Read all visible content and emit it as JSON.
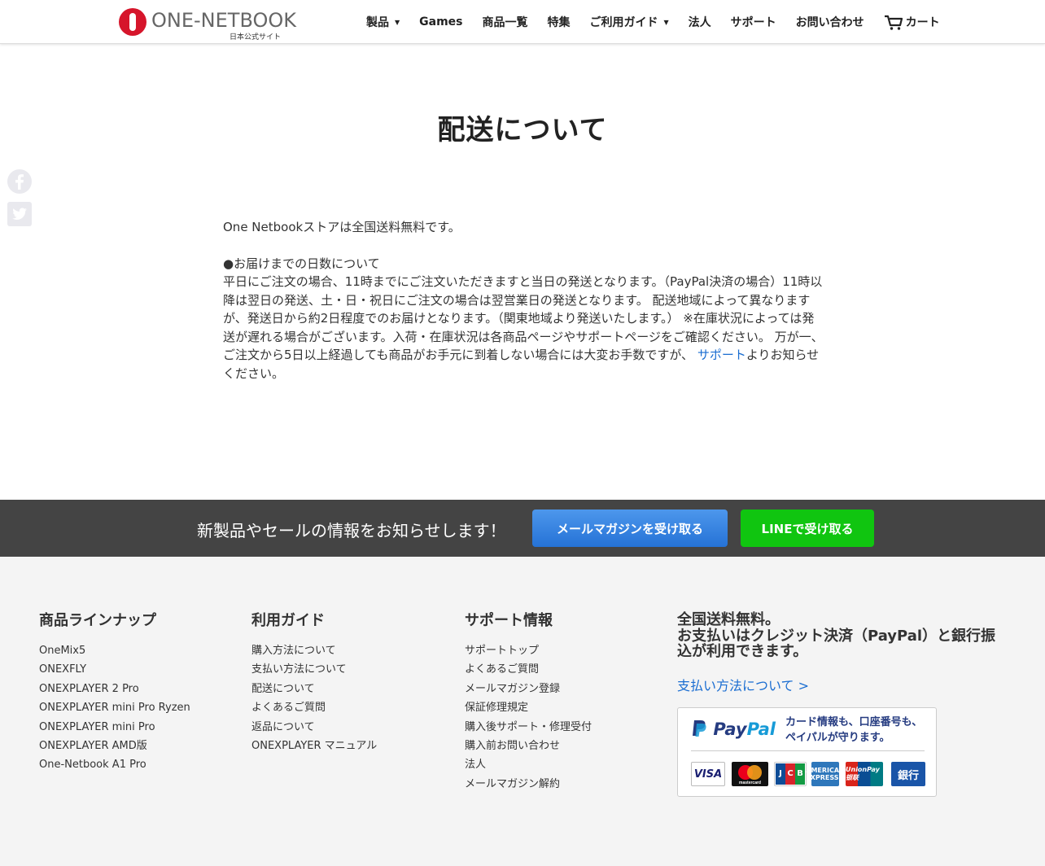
{
  "header": {
    "logo_text": "ONE-NETBOOK",
    "logo_sub": "日本公式サイト",
    "nav": [
      {
        "label": "製品",
        "has_dropdown": true
      },
      {
        "label": "Games",
        "has_dropdown": false
      },
      {
        "label": "商品一覧",
        "has_dropdown": false
      },
      {
        "label": "特集",
        "has_dropdown": false
      },
      {
        "label": "ご利用ガイド",
        "has_dropdown": true
      },
      {
        "label": "法人",
        "has_dropdown": false
      },
      {
        "label": "サポート",
        "has_dropdown": false
      },
      {
        "label": "お問い合わせ",
        "has_dropdown": false
      },
      {
        "label": "カート",
        "icon": "cart-icon"
      }
    ]
  },
  "social": [
    {
      "name": "Facebook",
      "icon": "facebook-icon",
      "color": "#e9e9ee"
    },
    {
      "name": "Twitter",
      "icon": "twitter-icon",
      "color": "#e9e9ee"
    }
  ],
  "main": {
    "title": "配送について",
    "intro": "One Netbookストアは全国送料無料です。",
    "section_heading": "●お届けまでの日数について",
    "body_before_link": "平日にご注文の場合、11時までにご注文いただきますと当日の発送となります。（PayPal決済の場合）11時以降は翌日の発送、土・日・祝日にご注文の場合は翌営業日の発送となります。 配送地域によって異なりますが、発送日から約2日程度でのお届けとなります。（関東地域より発送いたします。） ※在庫状況によっては発送が遅れる場合がございます。入荷・在庫状況は各商品ページやサポートページをご確認ください。 万が一、ご注文から5日以上経過しても商品がお手元に到着しない場合には大変お手数ですが、 ",
    "link_text": "サポート",
    "body_after_link": "よりお知らせください。"
  },
  "newsletter": {
    "text": "新製品やセールの情報をお知らせします！",
    "mail_button": "メールマガジンを受け取る",
    "line_button": "LINEで受け取る"
  },
  "footer": {
    "columns": [
      {
        "title": "商品ラインナップ",
        "items": [
          "OneMix5",
          "ONEXFLY",
          "ONEXPLAYER 2 Pro",
          "ONEXPLAYER mini Pro Ryzen",
          "ONEXPLAYER mini Pro",
          "ONEXPLAYER AMD版",
          "One-Netbook A1 Pro"
        ]
      },
      {
        "title": "利用ガイド",
        "items": [
          "購入方法について",
          "支払い方法について",
          "配送について",
          "よくあるご質問",
          "返品について",
          "ONEXPLAYER マニュアル"
        ]
      },
      {
        "title": "サポート情報",
        "items": [
          "サポートトップ",
          "よくあるご質問",
          "メールマガジン登録",
          "保証修理規定",
          "購入後サポート・修理受付",
          "購入前お問い合わせ",
          "法人",
          "メールマガジン解約"
        ]
      }
    ],
    "payment": {
      "line1": "全国送料無料。",
      "line2": "お支払いはクレジット決済（PayPal）と銀行振込が利用できます。",
      "link": "支払い方法について >",
      "paypal_pay": "Pay",
      "paypal_pal": "Pal",
      "paypal_tag1": "カード情報も、口座番号も、",
      "paypal_tag2": "ペイパルが守ります。",
      "cards": {
        "visa": "VISA",
        "mastercard": "mastercard",
        "amex": "AMERICAN EXPRESS",
        "unionpay": "UnionPay 银联",
        "bank": "銀行"
      }
    }
  },
  "colors": {
    "accent": "#d6152b",
    "link": "#1a6dd1",
    "line_green": "#10c510",
    "mail_blue": "#2572d6",
    "bar_bg": "#444444",
    "footer_bg": "#f4f4f4"
  }
}
